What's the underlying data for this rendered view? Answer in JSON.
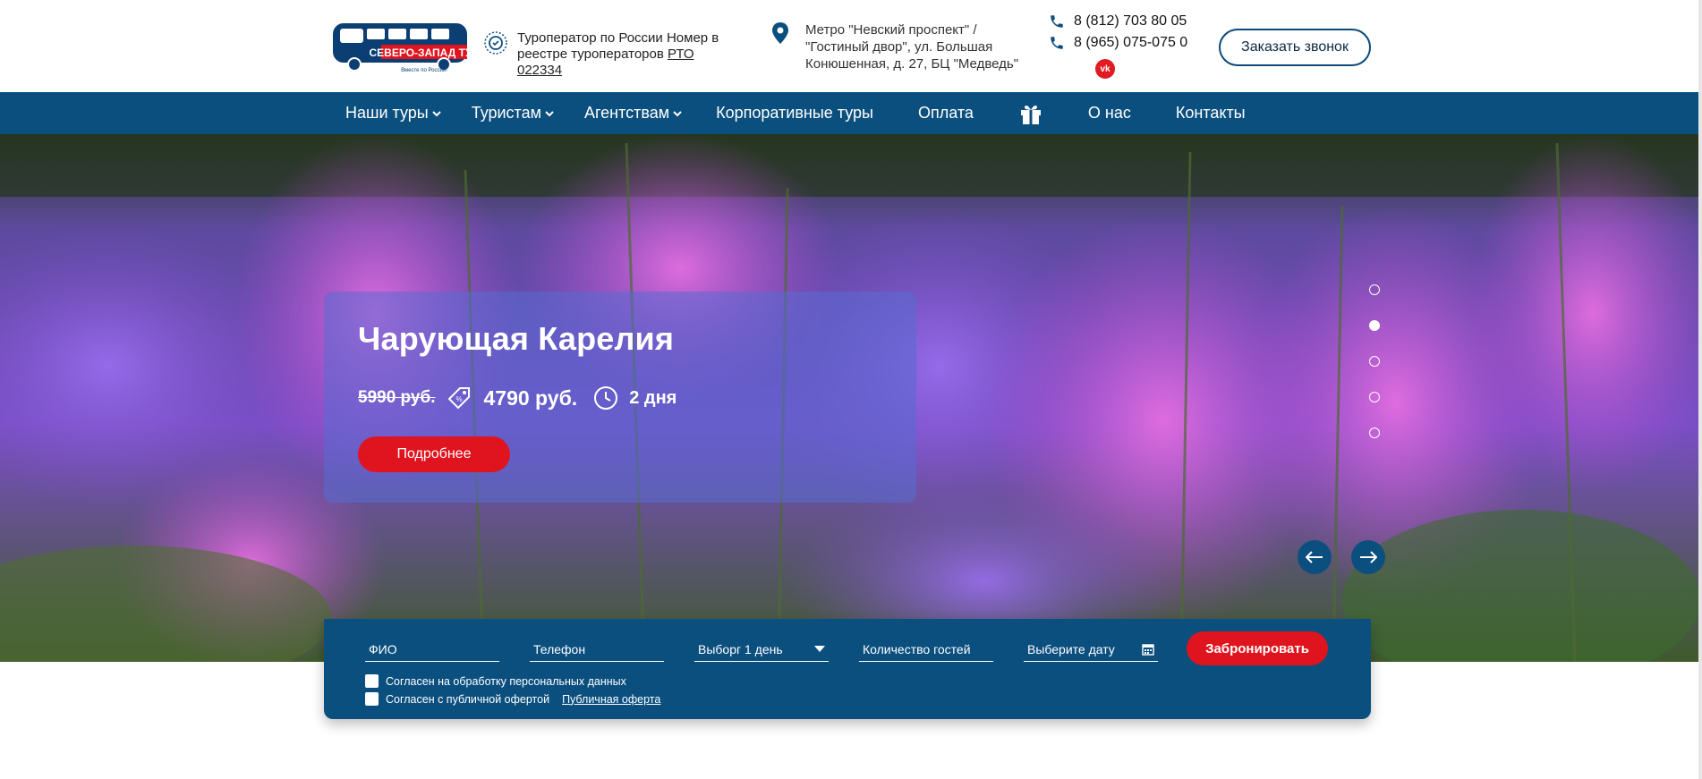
{
  "header": {
    "logo_text": "СЕВЕРО-ЗАПАД ТУР",
    "logo_tagline": "Вместе по России!",
    "operator_text": "Туроператор по России Номер в реестре туроператоров",
    "operator_link": "РТО 022334",
    "address": "Метро \"Невский проспект\" / \"Гостиный двор\", ул. Большая Конюшенная, д. 27, БЦ \"Медведь\"",
    "phones": [
      "8 (812) 703 80 05",
      "8 (965) 075-075 0"
    ],
    "vk_label": "vk",
    "callback_label": "Заказать звонок"
  },
  "nav": {
    "items": [
      {
        "label": "Наши туры",
        "dropdown": true
      },
      {
        "label": "Туристам",
        "dropdown": true
      },
      {
        "label": "Агентствам",
        "dropdown": true
      },
      {
        "label": "Корпоративные туры",
        "dropdown": false
      },
      {
        "label": "Оплата",
        "dropdown": false
      },
      {
        "label": "",
        "icon": "gift-icon"
      },
      {
        "label": "О нас",
        "dropdown": false
      },
      {
        "label": "Контакты",
        "dropdown": false
      }
    ]
  },
  "hero": {
    "title": "Чарующая Карелия",
    "old_price": "5990 руб.",
    "new_price": "4790 руб.",
    "duration": "2 дня",
    "more_label": "Подробнее",
    "slides_count": 5,
    "active_slide": 2
  },
  "booking": {
    "name_placeholder": "ФИО",
    "phone_placeholder": "Телефон",
    "tour_selected": "Выборг 1 день",
    "guests_placeholder": "Количество гостей",
    "date_placeholder": "Выберите дату",
    "submit_label": "Забронировать",
    "consent_personal": "Согласен на обработку персональных данных",
    "consent_offer": "Согласен с публичной офертой",
    "offer_link": "Публичная оферта"
  },
  "colors": {
    "brand_blue": "#0b4f7f",
    "accent_red": "#e0141e"
  }
}
